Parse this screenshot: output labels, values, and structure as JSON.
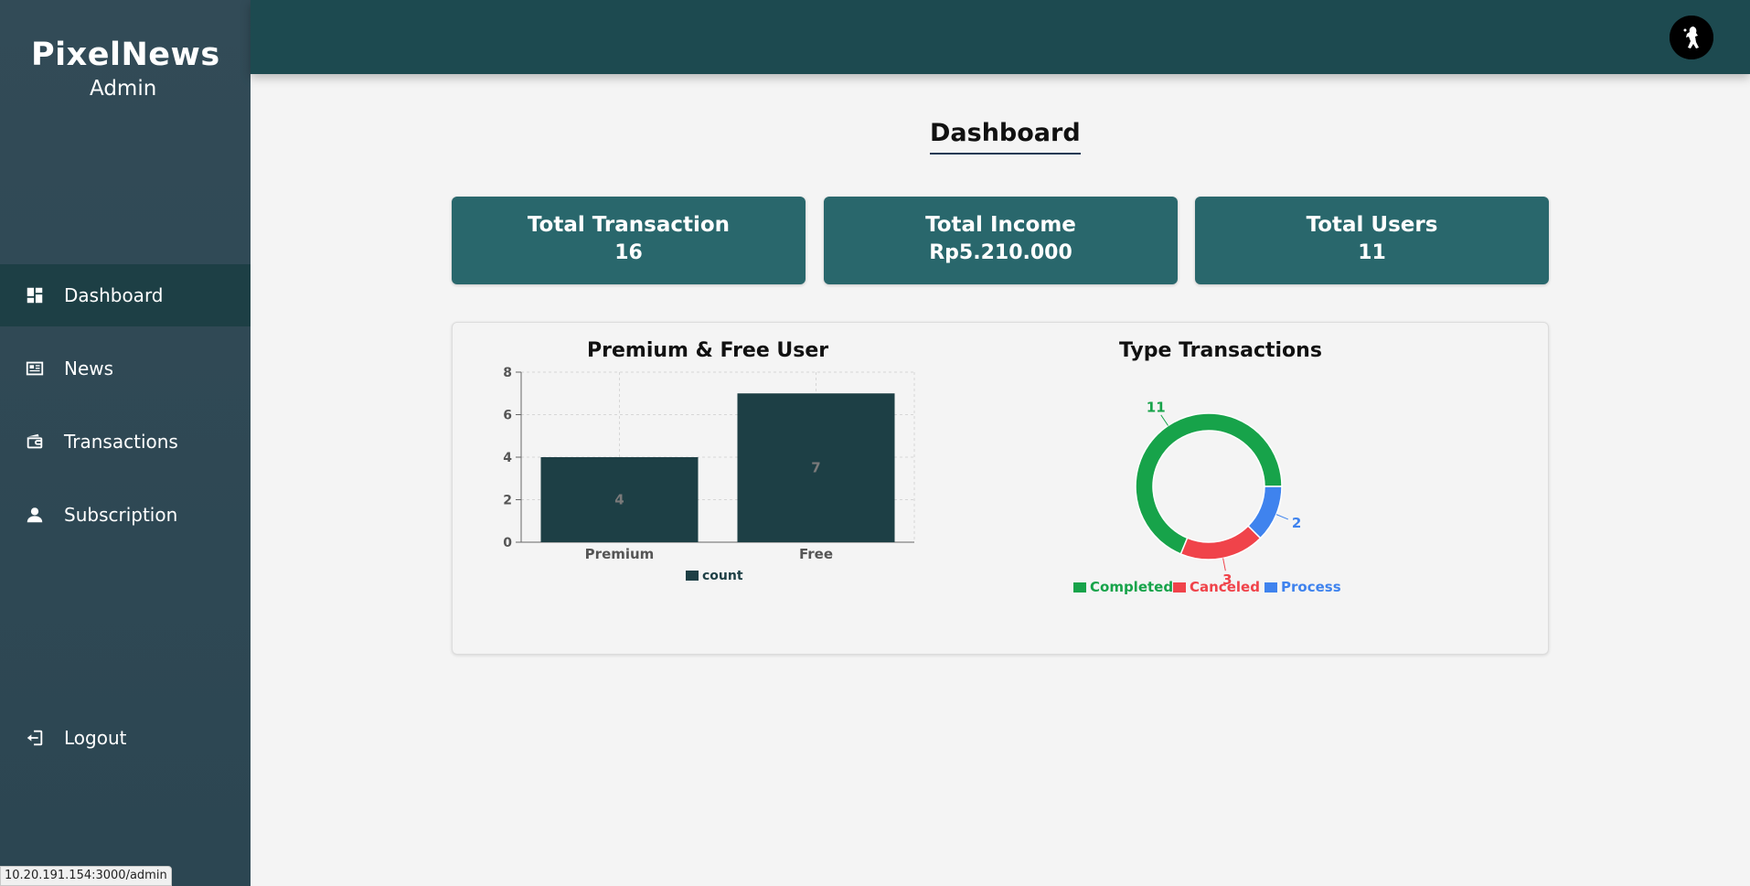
{
  "brand": {
    "title": "PixelNews",
    "subtitle": "Admin"
  },
  "sidebar": {
    "items": [
      {
        "label": "Dashboard",
        "icon": "dashboard-icon",
        "active": true
      },
      {
        "label": "News",
        "icon": "news-icon",
        "active": false
      },
      {
        "label": "Transactions",
        "icon": "wallet-icon",
        "active": false
      },
      {
        "label": "Subscription",
        "icon": "user-icon",
        "active": false
      }
    ],
    "logout": {
      "label": "Logout",
      "icon": "logout-icon"
    }
  },
  "page": {
    "title": "Dashboard"
  },
  "stats": [
    {
      "label": "Total Transaction",
      "value": "16"
    },
    {
      "label": "Total Income",
      "value": "Rp5.210.000"
    },
    {
      "label": "Total Users",
      "value": "11"
    }
  ],
  "charts": {
    "bar_title": "Premium & Free User",
    "donut_title": "Type Transactions"
  },
  "chart_data": [
    {
      "type": "bar",
      "title": "Premium & Free User",
      "categories": [
        "Premium",
        "Free"
      ],
      "series": [
        {
          "name": "count",
          "values": [
            4,
            7
          ],
          "color": "#1d3f45"
        }
      ],
      "ylim": [
        0,
        8
      ],
      "yticks": [
        0,
        2,
        4,
        6,
        8
      ],
      "grid": true,
      "legend": "bottom"
    },
    {
      "type": "pie",
      "title": "Type Transactions",
      "labels": [
        "Completed",
        "Canceled",
        "Process"
      ],
      "values": [
        11,
        3,
        2
      ],
      "colors": [
        "#17a34a",
        "#f0434a",
        "#3f83ee"
      ],
      "legend": "bottom"
    }
  ],
  "status_url": "10.20.191.154:3000/admin"
}
